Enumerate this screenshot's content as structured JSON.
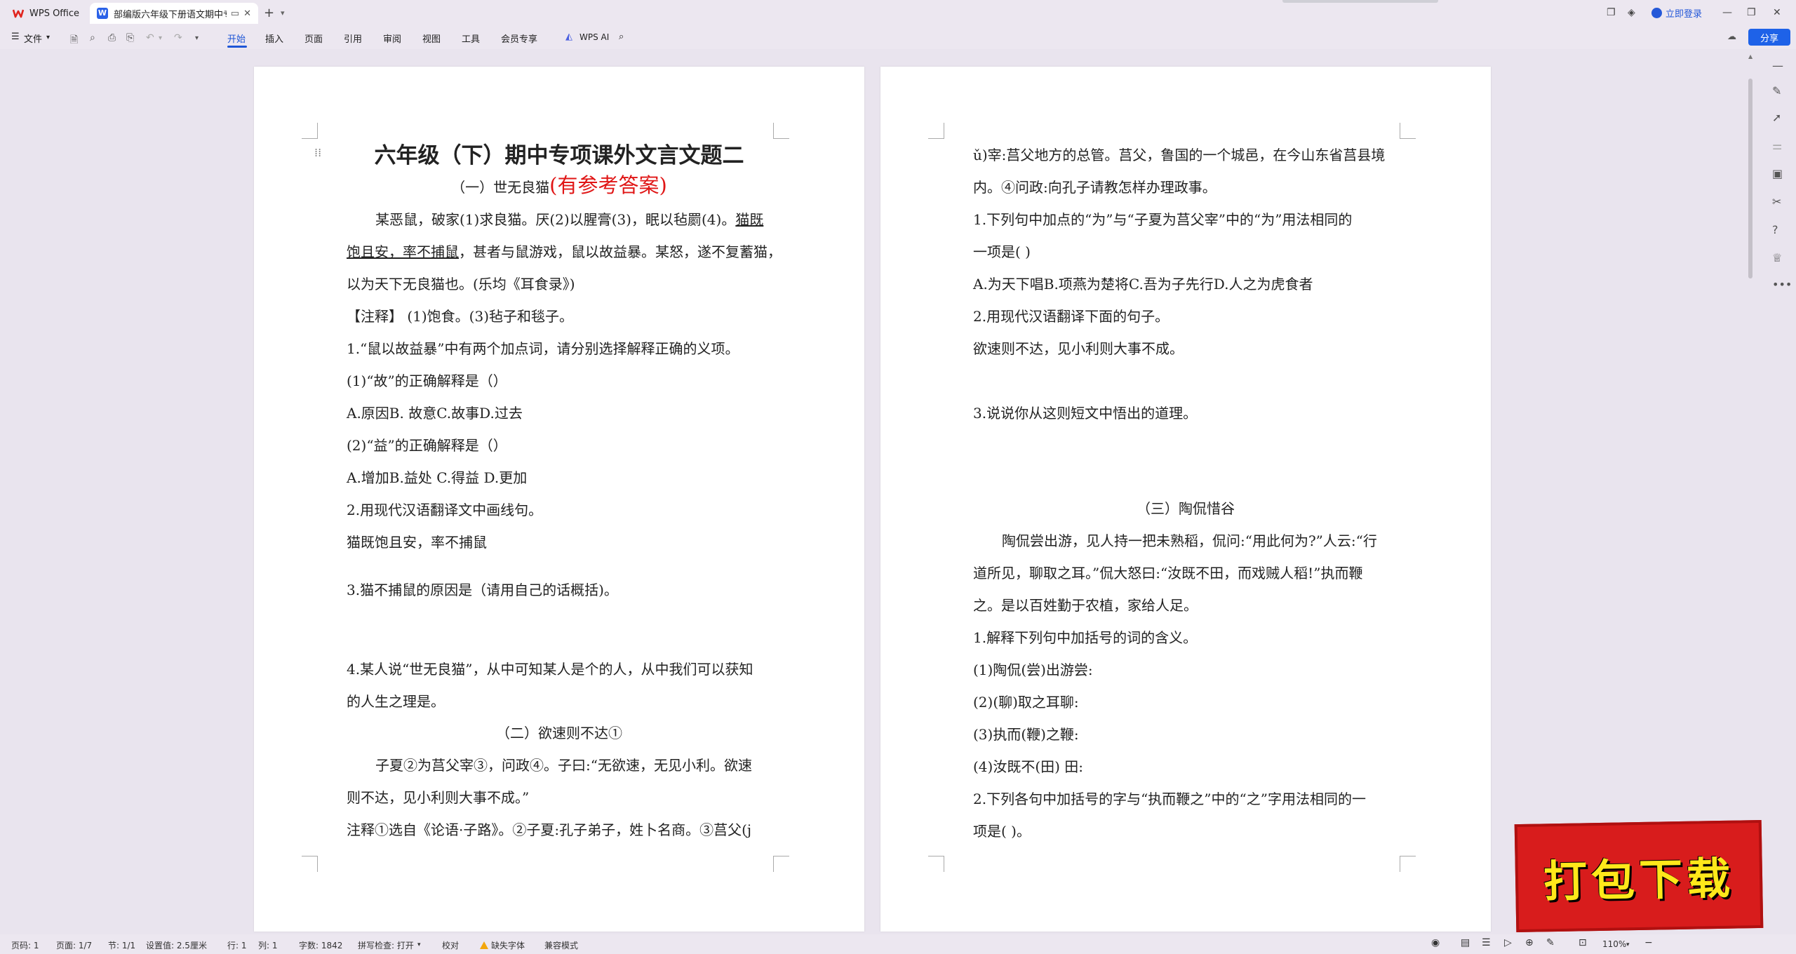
{
  "app": {
    "home_tab": "WPS Office",
    "doc_tab": "部编版六年级下册语文期中专"
  },
  "header": {
    "login": "立即登录",
    "share": "分享"
  },
  "ribbon": {
    "file": "文件",
    "tabs": [
      "开始",
      "插入",
      "页面",
      "引用",
      "审阅",
      "视图",
      "工具",
      "会员专享"
    ],
    "wps_ai": "WPS AI"
  },
  "page1": {
    "title": "六年级（下）期中专项课外文言文题二",
    "sec1_head": "（一）世无良猫",
    "sec1_head_red": "(有参考答案)",
    "p1_l1a": "某恶鼠，破家(1)求良猫。厌(2)以腥膏(3)，眠以毡罽(4)。",
    "p1_l1b": "猫既",
    "p1_l2a": "饱且安，率不捕鼠",
    "p1_l2b": "，甚者与鼠游戏，鼠以故益暴。某怒，遂不复蓄猫，",
    "p1_l3": "以为天下无良猫也。(乐均《耳食录》)",
    "note1": "【注释】 (1)饱食。(3)毡子和毯子。",
    "q1": "1.“鼠以故益暴”中有两个加点词，请分别选择解释正确的义项。",
    "q1_1": "(1)“故”的正确解释是（）",
    "q1_1_opts": "A.原因B.  故意C.故事D.过去",
    "q1_2": "(2)“益”的正确解释是（）",
    "q1_2_opts": "A.增加B.益处 C.得益 D.更加",
    "q2": "2.用现代汉语翻译文中画线句。",
    "q2_line": "猫既饱且安，率不捕鼠",
    "q3": "3.猫不捕鼠的原因是（请用自己的话概括)。",
    "q4_l1": "4.某人说“世无良猫”，从中可知某人是个的人，从中我们可以获知",
    "q4_l2": "的人生之理是。",
    "sec2_head": "（二）欲速则不达①",
    "p2_l1": "子夏②为莒父宰③，问政④。子曰:“无欲速，无见小利。欲速",
    "p2_l2": "则不达，见小利则大事不成。”",
    "note2": "注释①选自《论语·子路》。②子夏:孔子弟子，姓卜名商。③莒父(j"
  },
  "page2": {
    "l1": "ǔ)宰:莒父地方的总管。莒父，鲁国的一个城邑，在今山东省莒县境",
    "l2": "内。④问政:向孔子请教怎样办理政事。",
    "q1_l1": "1.下列句中加点的“为”与“子夏为莒父宰”中的“为”用法相同的",
    "q1_l2": "一项是( )",
    "q1_opts": "A.为天下唱B.项燕为楚将C.吾为子先行D.人之为虎食者",
    "q2": "2.用现代汉语翻译下面的句子。",
    "q2_line": "欲速则不达，见小利则大事不成。",
    "q3": "3.说说你从这则短文中悟出的道理。",
    "sec3_head": "（三）陶侃惜谷",
    "p3_l1": "陶侃尝出游，见人持一把未熟稻，侃问:“用此何为?”人云:“行",
    "p3_l2": "道所见，聊取之耳。”侃大怒曰:“汝既不田，而戏贼人稻!”执而鞭",
    "p3_l3": "之。是以百姓勤于农植，家给人足。",
    "q31": "1.解释下列句中加括号的词的含义。",
    "q31_1": "(1)陶侃(尝)出游尝:",
    "q31_2": "(2)(聊)取之耳聊:",
    "q31_3": "(3)执而(鞭)之鞭:",
    "q31_4": "(4)汝既不(田) 田:",
    "q32_l1": "2.下列各句中加括号的字与“执而鞭之”中的“之”字用法相同的一",
    "q32_l2": "项是( )。"
  },
  "status": {
    "page_num": "页码: 1",
    "pages": "页面: 1/7",
    "section": "节: 1/1",
    "setting": "设置值: 2.5厘米",
    "row": "行: 1",
    "col": "列: 1",
    "words": "字数: 1842",
    "spell": "拼写检查: 打开",
    "proof": "校对",
    "missing_font": "缺失字体",
    "compat": "兼容模式",
    "zoom": "110%"
  },
  "ad": {
    "text": "打包下载"
  }
}
